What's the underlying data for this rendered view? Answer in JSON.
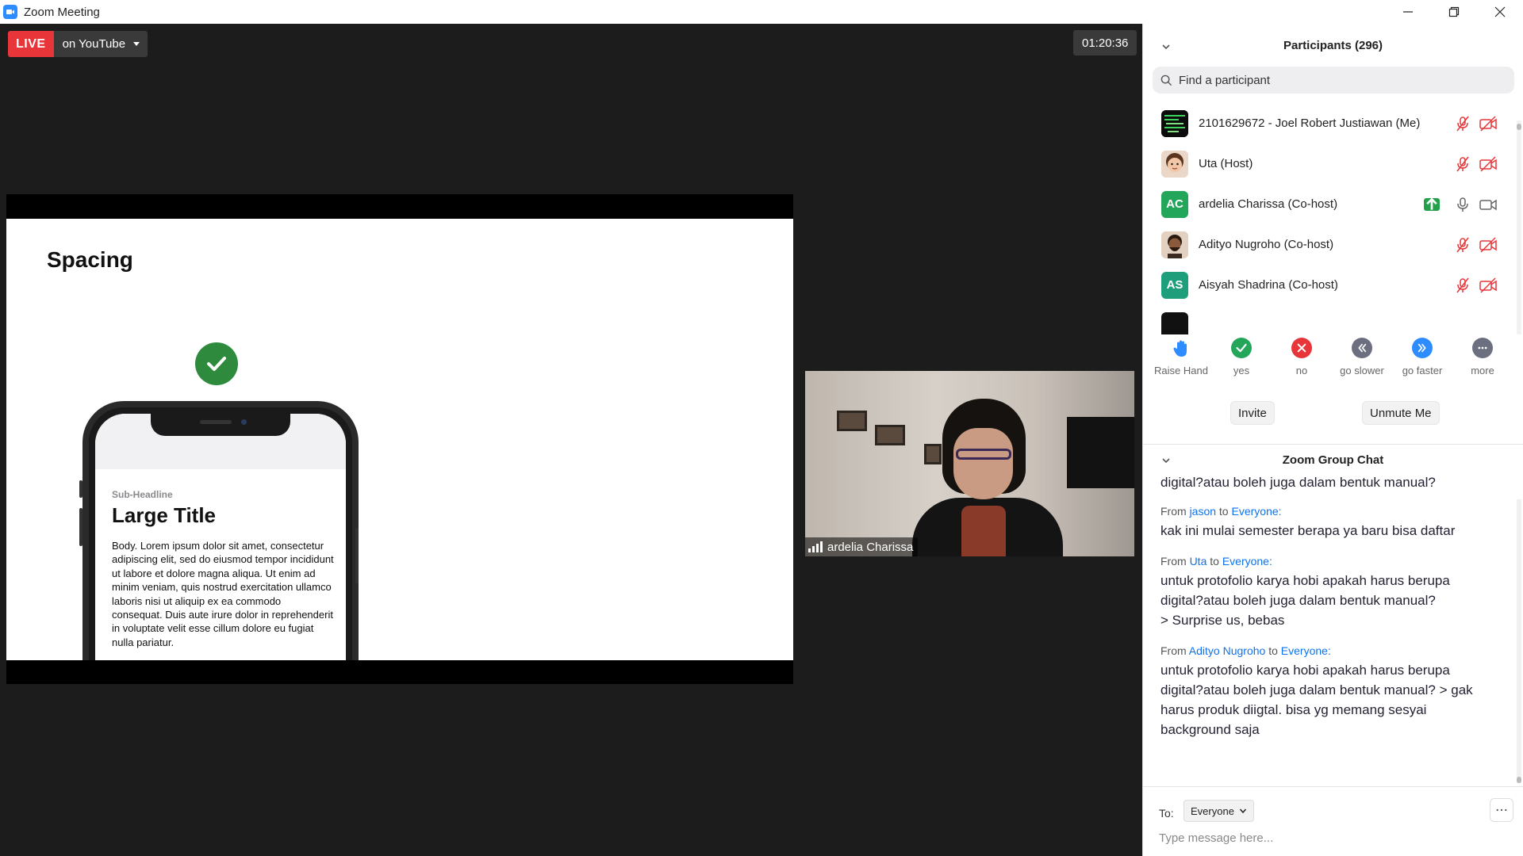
{
  "window": {
    "title": "Zoom Meeting"
  },
  "live": {
    "badge": "LIVE",
    "platform": "on YouTube"
  },
  "meeting": {
    "timer": "01:20:36"
  },
  "slide": {
    "title": "Spacing",
    "phone": {
      "sub_headline": "Sub-Headline",
      "large_title": "Large Title",
      "body": "Body. Lorem ipsum dolor sit amet, consectetur adipiscing elit, sed do eiusmod tempor incididunt ut labore et dolore magna aliqua. Ut enim ad minim veniam, quis nostrud exercitation ullamco laboris nisi ut aliquip ex ea commodo consequat. Duis aute irure dolor in reprehenderit in voluptate velit esse cillum dolore eu fugiat nulla pariatur."
    }
  },
  "speaker": {
    "name": "ardelia Charissa"
  },
  "participants": {
    "title": "Participants (296)",
    "search_placeholder": "Find a participant",
    "list": [
      {
        "name": "2101629672 - Joel Robert Justiawan (Me)",
        "avatar": "image",
        "mic": "muted",
        "video": "off"
      },
      {
        "name": "Uta (Host)",
        "avatar": "image",
        "mic": "muted",
        "video": "off"
      },
      {
        "name": "ardelia Charissa (Co-host)",
        "avatar": "AC",
        "avatar_color": "#23a55a",
        "mic": "on",
        "video": "on",
        "sharing": true
      },
      {
        "name": "Adityo Nugroho (Co-host)",
        "avatar": "image",
        "mic": "muted",
        "video": "off"
      },
      {
        "name": "Aisyah Shadrina (Co-host)",
        "avatar": "AS",
        "avatar_color": "#1e9e7a",
        "mic": "muted",
        "video": "off"
      }
    ],
    "reactions": [
      {
        "label": "Raise Hand",
        "icon": "raise-hand-icon",
        "color": "#2d8cff"
      },
      {
        "label": "yes",
        "icon": "check-icon",
        "color": "#23a55a"
      },
      {
        "label": "no",
        "icon": "x-icon",
        "color": "#e8353a"
      },
      {
        "label": "go slower",
        "icon": "rewind-icon",
        "color": "#6b6f80"
      },
      {
        "label": "go faster",
        "icon": "fast-forward-icon",
        "color": "#2d8cff"
      },
      {
        "label": "more",
        "icon": "more-icon",
        "color": "#6b6f80"
      }
    ],
    "invite_label": "Invite",
    "unmute_label": "Unmute Me"
  },
  "chat": {
    "title": "Zoom Group Chat",
    "partial_top": "digital?atau boleh juga dalam bentuk manual?",
    "messages": [
      {
        "from_prefix": "From",
        "sender": "jason",
        "to_word": "to",
        "recipient": "Everyone:",
        "text": "kak ini mulai semester berapa ya baru bisa daftar"
      },
      {
        "from_prefix": "From",
        "sender": "Uta",
        "to_word": "to",
        "recipient": "Everyone:",
        "text": "untuk protofolio karya hobi apakah harus berupa digital?atau boleh juga dalam bentuk manual?\n> Surprise us, bebas"
      },
      {
        "from_prefix": "From",
        "sender": "Adityo Nugroho",
        "to_word": "to",
        "recipient": "Everyone:",
        "text": "untuk protofolio karya hobi apakah harus berupa digital?atau boleh juga dalam bentuk manual? > gak harus produk diigtal. bisa yg memang sesyai background saja"
      }
    ],
    "to_label": "To:",
    "to_value": "Everyone",
    "input_placeholder": "Type message here..."
  }
}
